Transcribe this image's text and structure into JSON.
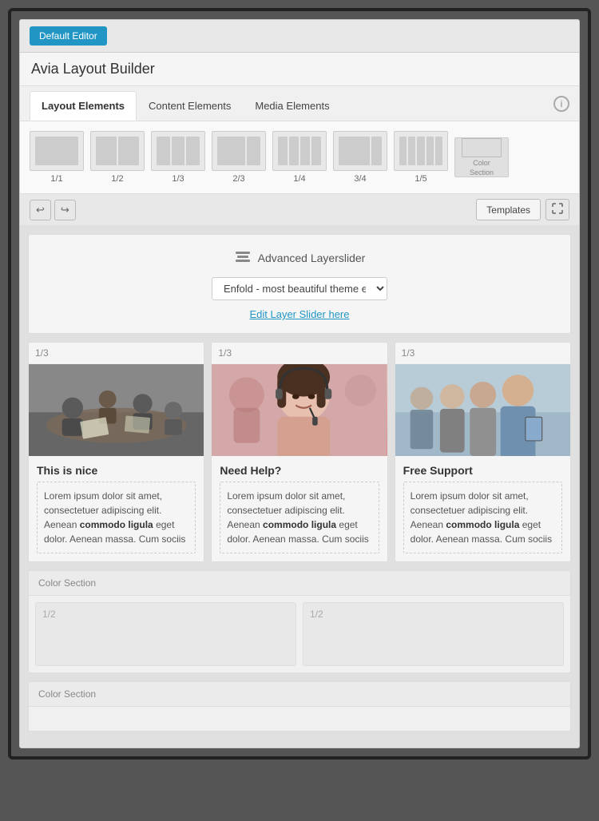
{
  "topBar": {
    "defaultEditorLabel": "Default Editor"
  },
  "builderHeader": {
    "title": "Avia Layout Builder"
  },
  "tabs": {
    "items": [
      {
        "id": "layout",
        "label": "Layout Elements",
        "active": true
      },
      {
        "id": "content",
        "label": "Content Elements",
        "active": false
      },
      {
        "id": "media",
        "label": "Media Elements",
        "active": false
      }
    ]
  },
  "elements": [
    {
      "id": "one-one",
      "label": "1/1",
      "cols": 1
    },
    {
      "id": "one-two",
      "label": "1/2",
      "cols": 2
    },
    {
      "id": "one-three",
      "label": "1/3",
      "cols": 3
    },
    {
      "id": "two-three",
      "label": "2/3",
      "cols": 4
    },
    {
      "id": "one-four",
      "label": "1/4",
      "cols": 5
    },
    {
      "id": "three-four",
      "label": "3/4",
      "cols": 6
    },
    {
      "id": "one-five",
      "label": "1/5",
      "cols": 7
    },
    {
      "id": "color-section",
      "label": "Color Section",
      "type": "special"
    }
  ],
  "toolbar": {
    "undoLabel": "↩",
    "redoLabel": "↪",
    "templatesLabel": "Templates",
    "fullscreenLabel": "⛶"
  },
  "layerSlider": {
    "iconLabel": "Advanced Layerslider",
    "selectValue": "Enfold - most beautiful theme ever",
    "editLink": "Edit Layer Slider here"
  },
  "columns": [
    {
      "label": "1/3",
      "imageAlt": "Business meeting",
      "contentTitle": "This is nice",
      "contentText": "Lorem ipsum dolor sit amet, consectetuer adipiscing elit. Aenean ",
      "contentBold": "commodo ligula",
      "contentText2": " eget dolor. Aenean massa. Cum sociis"
    },
    {
      "label": "1/3",
      "imageAlt": "Headset woman",
      "contentTitle": "Need Help?",
      "contentText": "Lorem ipsum dolor sit amet, consectetuer adipiscing elit. Aenean ",
      "contentBold": "commodo ligula",
      "contentText2": " eget dolor. Aenean massa. Cum sociis"
    },
    {
      "label": "1/3",
      "imageAlt": "Business team",
      "contentTitle": "Free Support",
      "contentText": "Lorem ipsum dolor sit amet, consectetuer adipiscing elit. Aenean ",
      "contentBold": "commodo ligula",
      "contentText2": " eget dolor. Aenean massa. Cum sociis"
    }
  ],
  "colorSections": [
    {
      "label": "Color Section",
      "cols": [
        {
          "label": "1/2"
        },
        {
          "label": "1/2"
        }
      ]
    },
    {
      "label": "Color Section",
      "cols": []
    }
  ],
  "colors": {
    "accent": "#2196c4",
    "tabActiveBg": "#ffffff",
    "sectionBg": "#f5f5f5"
  }
}
